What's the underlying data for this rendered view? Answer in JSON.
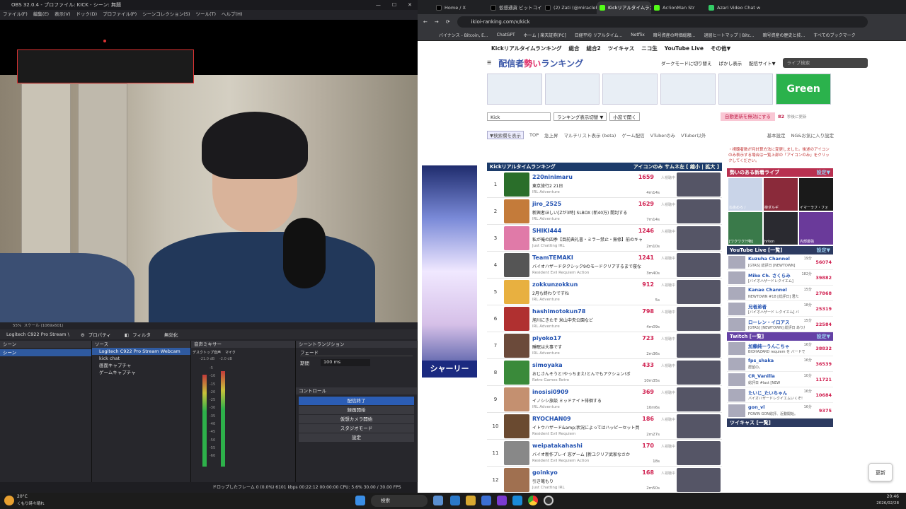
{
  "obs": {
    "title": "OBS 32.0.4 - プロファイル: KICK - シーン: 無題",
    "menu": [
      "ファイル(F)",
      "編集(E)",
      "表示(V)",
      "ドック(D)",
      "プロファイル(P)",
      "シーンコレクション(S)",
      "ツール(T)",
      "ヘルプ(H)"
    ],
    "status_zoom": "55%",
    "status_scale": "スケール (1069x601)",
    "source_name": "Logitech C922 Pro Stream \\",
    "properties_label": "プロパティ",
    "filters_label": "フィルタ",
    "disable_label": "無効化",
    "scenes_header": "シーン",
    "scene_item": "シーン",
    "sources_header": "ソース",
    "sources": [
      "Logitech C922 Pro Stream Webcam",
      "kick chat",
      "画面キャプチャ",
      "ゲームキャプチャ"
    ],
    "mixer_header": "音声ミキサー",
    "mixer_desktop": "デスクトップ音声",
    "mixer_mic": "マイク",
    "mixer_db_desktop": "-21.0 dB",
    "mixer_db_mic": "-2.0 dB",
    "mixer_scale": [
      "-5",
      "-10",
      "-15",
      "-20",
      "-25",
      "-30",
      "-35",
      "-40",
      "-45",
      "-50",
      "-55",
      "-60"
    ],
    "transition_header": "シーントランジション",
    "transition_type": "フェード",
    "duration_label": "期間",
    "duration_value": "100 ms",
    "controls_header": "コントロール",
    "controls": [
      "配信終了",
      "録画開始",
      "仮想カメラ開始",
      "スタジオモード",
      "設定"
    ],
    "footer": "ドロップしたフレーム 0 (0.0%)   6101 kbps   00:22:12   00:00:00   CPU: 5.6%  30.00 / 30.00 FPS"
  },
  "browser": {
    "tabs": [
      "Home / X",
      "仮想通貨 ビットコイン",
      "(2) Zati (@miraclebi",
      "Kickリアルタイムランキ",
      "Ac!ionMan Str",
      "Azari Video Chat w"
    ],
    "tab_colors": [
      "#53fc18",
      "#000000",
      "#000000",
      "#000000",
      "#53fc18",
      "#33cc66"
    ],
    "active_tab": 3,
    "url": "ikioi-ranking.com/v/kick",
    "bookmarks": [
      "バイナンス - Bitcoin, E...",
      "ChatGPT",
      "ホーム | 楽天証券[PC]",
      "日経平均 リアルタイム...",
      "Netflix",
      "暗号資産の時価総額...",
      "退屈ヒートマップ | Bitc...",
      "暗号資産の歴史と技..."
    ],
    "all_bookmarks": "すべてのブックマーク"
  },
  "site": {
    "topnav": [
      "Kickリアルタイムランキング",
      "総合",
      "総合2",
      "ツイキャス",
      "ニコ生",
      "YouTube Live",
      "その他▼"
    ],
    "logo_main": "配信者",
    "logo_accent": "勢い",
    "logo_tail": "ランキング",
    "nav_right": [
      "ダークモードに切り替え",
      "ぱかし表示",
      "配信サイト▼"
    ],
    "search_placeholder": "ライブ検索",
    "ad_label": "Green",
    "filter_select": "Kick",
    "filter_rank": "ランキング表示切替 ▼",
    "filter_open": "小窓で開く",
    "auto_refresh": "自動更新を無効にする",
    "auto_count": "82",
    "auto_note": "秒後に更新",
    "search_toggle": "▼検索欄を表示",
    "subtabs": [
      "TOP",
      "急上昇",
      "マルチリスト表示 (beta)",
      "ゲーム配信",
      "VTuberのみ",
      "VTuber以外"
    ],
    "subtabs_right": [
      "基本設定",
      "NG&お気に入り設定"
    ],
    "notice": "・視聴者数が月計算方法に変更しました。後述のアイコンのみ表示する場合は一覧上部の「アイコンのみ」をクリックしてください。",
    "rank_title": "Kickリアルタイムランキング",
    "rank_options": "アイコンのみ サムネ左 [ 縮小 | 拡大 ]",
    "viewer_unit": "人視聴中",
    "rows": [
      {
        "rank": "1",
        "name": "220ninimaru",
        "title": "東京旅行2 21日",
        "cat": "IRL Adventure",
        "viewers": "1659",
        "time": "4m14s",
        "color": "#2a6e2a"
      },
      {
        "rank": "2",
        "name": "jiro_2525",
        "title": "新興者ほしい[Zが3時] SLBOX (新40万) 開封する",
        "cat": "IRL Adventure",
        "viewers": "1629",
        "time": "7m14s",
        "color": "#c47b3a"
      },
      {
        "rank": "3",
        "name": "SHIKI444",
        "title": "私が俺の四季【目前典礼書・ミラー禁止・無修】前のキャブテ",
        "cat": "Just Chatting IRL",
        "viewers": "1246",
        "time": "2m10s",
        "color": "#e07aa8"
      },
      {
        "rank": "4",
        "name": "TeamTEMAKI",
        "title": "バイオハザードタクシック9のモードクリアするまで寝な",
        "cat": "Resident Evil Requiem Action",
        "viewers": "1241",
        "time": "3m40s",
        "color": "#555"
      },
      {
        "rank": "5",
        "name": "zokkunzokkun",
        "title": "2月も終わりですね",
        "cat": "IRL Adventure",
        "viewers": "912",
        "time": "5s",
        "color": "#e8b040"
      },
      {
        "rank": "6",
        "name": "hashimotokun78",
        "title": "旭川にきたぞ 米山中央公園など",
        "cat": "IRL Adventure",
        "viewers": "798",
        "time": "4m09s",
        "color": "#b03030"
      },
      {
        "rank": "7",
        "name": "piyoko17",
        "title": "睡眠は大事です",
        "cat": "IRL Adventure",
        "viewers": "723",
        "time": "2m36s",
        "color": "#6b4a3a"
      },
      {
        "rank": "8",
        "name": "simoyaka",
        "title": "おじさんそうと!やっちまえ!とんでもアクション!ボ",
        "cat": "Retro Games Retro",
        "viewers": "433",
        "time": "10m35s",
        "color": "#3a8a3a"
      },
      {
        "rank": "9",
        "name": "inosisi0909",
        "title": "イノシシ旅談 ミッドナイト徘徊する",
        "cat": "IRL Adventure",
        "viewers": "369",
        "time": "10m6s",
        "color": "#c49070"
      },
      {
        "rank": "10",
        "name": "RYOCHAN09",
        "title": "イトウハザード&amp;状況によってはハッピーセット買",
        "cat": "Resident Evil Requiem",
        "viewers": "186",
        "time": "2m27s",
        "color": "#6a4a30"
      },
      {
        "rank": "11",
        "name": "weipatakahashi",
        "title": "バイオ新作プレイ 窓ゲーム [新ユクリア武家なさか",
        "cat": "Resident Evil Requiem Action",
        "viewers": "170",
        "time": "18s",
        "color": "#888"
      },
      {
        "rank": "12",
        "name": "goinkyo",
        "title": "引き篭もり",
        "cat": "Just Chatting IRL",
        "viewers": "168",
        "time": "2m50s",
        "color": "#a07050"
      }
    ],
    "side_new_title": "勢いのある新着ライブ",
    "side_more": "設定▼",
    "new_lives": [
      "ねあめろ /",
      "柳ダルギ",
      "イマーラフ・フォ",
      "[ワクワク汁物]",
      "hrkon",
      "内部最強"
    ],
    "youtube_title": "YouTube Live",
    "youtube_more": "[一覧]",
    "youtube": [
      {
        "name": "Kuzuha Channel",
        "title": "[GTAS] 総評日 [NEWTOWN]",
        "viewers": "56074",
        "time": "19分"
      },
      {
        "name": "Miko Ch. さくらみ",
        "title": "[バイオハザードレクイエム]",
        "viewers": "39882",
        "time": "182分"
      },
      {
        "name": "Kanae Channel",
        "title": "NEWTOWN #18 [総評日] 君た",
        "viewers": "27868",
        "time": "15分"
      },
      {
        "name": "兄者弟者",
        "title": "[バイオハザード レクイエム] バ",
        "viewers": "25319",
        "time": "18分"
      },
      {
        "name": "ローレン・イロアス",
        "title": "[GTAS] [NEWTOWN] 総評日 ありがとう",
        "viewers": "22584",
        "time": "15分"
      }
    ],
    "twitch_title": "Twitch",
    "twitch_more": "[一覧]",
    "twitch": [
      {
        "name": "加藤純一うんこちゃ",
        "title": "BIOHAZARD requiem を バードで",
        "viewers": "38832",
        "time": "16分"
      },
      {
        "name": "fps_shaka",
        "title": "居留の。",
        "viewers": "36539",
        "time": "16分"
      },
      {
        "name": "CR_Vanilla",
        "title": "総評日 #last [NEW",
        "viewers": "11721",
        "time": "10分"
      },
      {
        "name": "たいじ_たいちゃん",
        "title": "バイオハザードレクイエムいくぞ!",
        "viewers": "10684",
        "time": "16分"
      },
      {
        "name": "gon_vl",
        "title": "FGWIN GON総評、近動開始。",
        "viewers": "9375",
        "time": "16分"
      }
    ],
    "twicas_title": "ツイキャス",
    "twicas_more": "[一覧]",
    "left_ad_cta": "シャーリー",
    "refresh_btn": "更新"
  },
  "taskbar": {
    "weather_temp": "20°C",
    "weather_desc": "くもり時々晴れ",
    "search": "検索",
    "time": "20:46",
    "date": "2026/02/28"
  }
}
